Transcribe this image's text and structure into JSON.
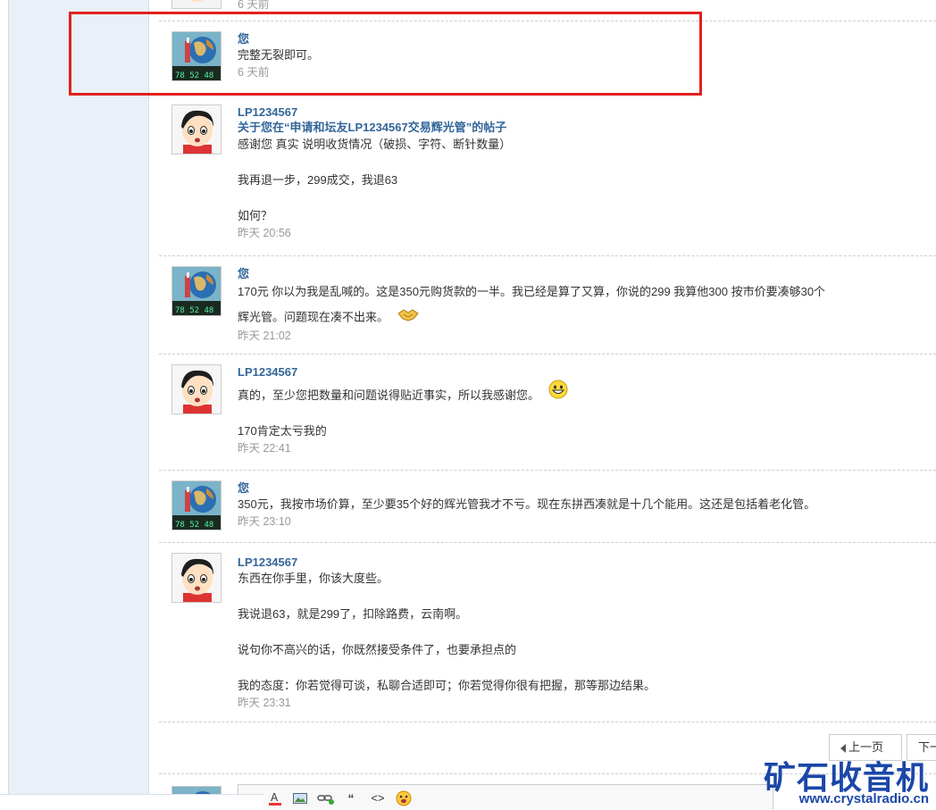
{
  "previous_tail": {
    "time": "6 天前"
  },
  "messages": [
    {
      "author": "您",
      "subject": "",
      "lines": [
        "完整无裂即可。"
      ],
      "time": "6 天前",
      "avatar": "globe-avatar-icon"
    },
    {
      "author": "LP1234567",
      "subject": "关于您在“申请和坛友LP1234567交易辉光管”的帖子",
      "lines": [
        "感谢您 真实 说明收货情况（破损、字符、断针数量）",
        "",
        "我再退一步，299成交，我退63",
        "",
        "如何？"
      ],
      "time": "昨天 20:56",
      "avatar": "cartoon-boy-avatar-icon"
    },
    {
      "author": "您",
      "subject": "",
      "lines": [
        "170元 你以为我是乱喊的。这是350元购货款的一半。我已经是算了又算，你说的299 我算他300  按市价要凑够30个",
        "辉光管。问题现在凑不出来。"
      ],
      "emoji": "handshake-icon",
      "time": "昨天 21:02",
      "avatar": "globe-avatar-icon"
    },
    {
      "author": "LP1234567",
      "subject": "",
      "lines": [
        "真的，至少您把数量和问题说得贴近事实，所以我感谢您。",
        "",
        "170肯定太亏我的"
      ],
      "emoji": "grin-smiley-icon",
      "time": "昨天 22:41",
      "avatar": "cartoon-boy-avatar-icon"
    },
    {
      "author": "您",
      "subject": "",
      "lines": [
        "350元，我按市场价算，至少要35个好的辉光管我才不亏。现在东拼西凑就是十几个能用。这还是包括着老化管。"
      ],
      "time": "昨天 23:10",
      "avatar": "globe-avatar-icon"
    },
    {
      "author": "LP1234567",
      "subject": "",
      "lines": [
        "东西在你手里，你该大度些。",
        "",
        "我说退63，就是299了，扣除路费，云南啊。",
        "",
        "说句你不高兴的话，你既然接受条件了，也要承担点的",
        "",
        "我的态度：你若觉得可谈，私聊合适即可；你若觉得你很有把握，那等那边结果。"
      ],
      "time": "昨天 23:31",
      "avatar": "cartoon-boy-avatar-icon"
    }
  ],
  "pager": {
    "prev_label": "上一页",
    "next_label": "下一"
  },
  "editor": {
    "tools": [
      {
        "icon": "font-color-icon",
        "glyph": "A"
      },
      {
        "icon": "image-icon",
        "glyph": ""
      },
      {
        "icon": "link-icon",
        "glyph": ""
      },
      {
        "icon": "quote-icon",
        "glyph": "“"
      },
      {
        "icon": "code-icon",
        "glyph": "<>"
      },
      {
        "icon": "smiley-icon",
        "glyph": ""
      }
    ]
  },
  "watermark": {
    "title": "矿石收音机",
    "url": "www.crystalradio.cn"
  },
  "colors": {
    "link": "#336699",
    "highlight_border": "#e0201e",
    "watermark": "#1a47a8",
    "time": "#999999"
  }
}
